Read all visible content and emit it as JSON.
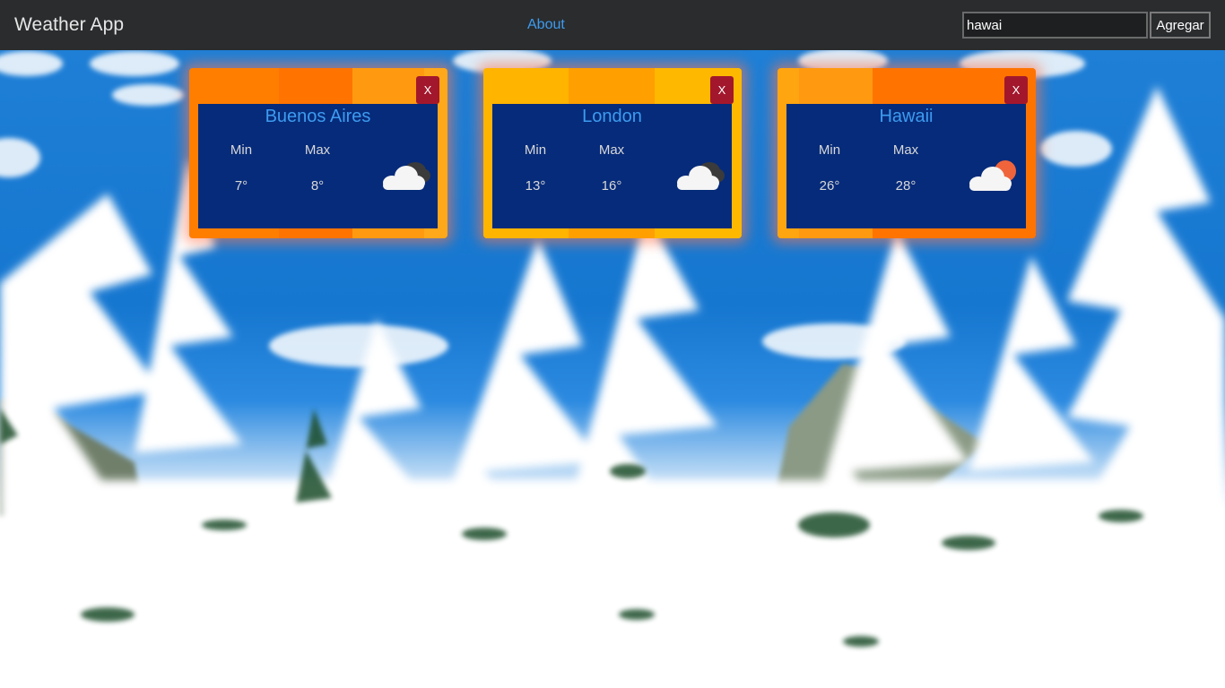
{
  "navbar": {
    "brand": "Weather App",
    "about_link": "About",
    "search": {
      "value": "hawai",
      "button_label": "Agregar"
    }
  },
  "cards": [
    {
      "city": "Buenos Aires",
      "min_label": "Min",
      "max_label": "Max",
      "min": "7°",
      "max": "8°",
      "close_label": "X",
      "icon": "cloudy-night-icon"
    },
    {
      "city": "London",
      "min_label": "Min",
      "max_label": "Max",
      "min": "13°",
      "max": "16°",
      "close_label": "X",
      "icon": "cloudy-night-icon"
    },
    {
      "city": "Hawaii",
      "min_label": "Min",
      "max_label": "Max",
      "min": "26°",
      "max": "28°",
      "close_label": "X",
      "icon": "partly-sunny-icon"
    }
  ],
  "colors": {
    "navbar_bg": "#2a2c2e",
    "link": "#3d9bf0",
    "card_inner": "#062b7a",
    "close_button": "#a3172d",
    "sky": "#1677d0"
  }
}
